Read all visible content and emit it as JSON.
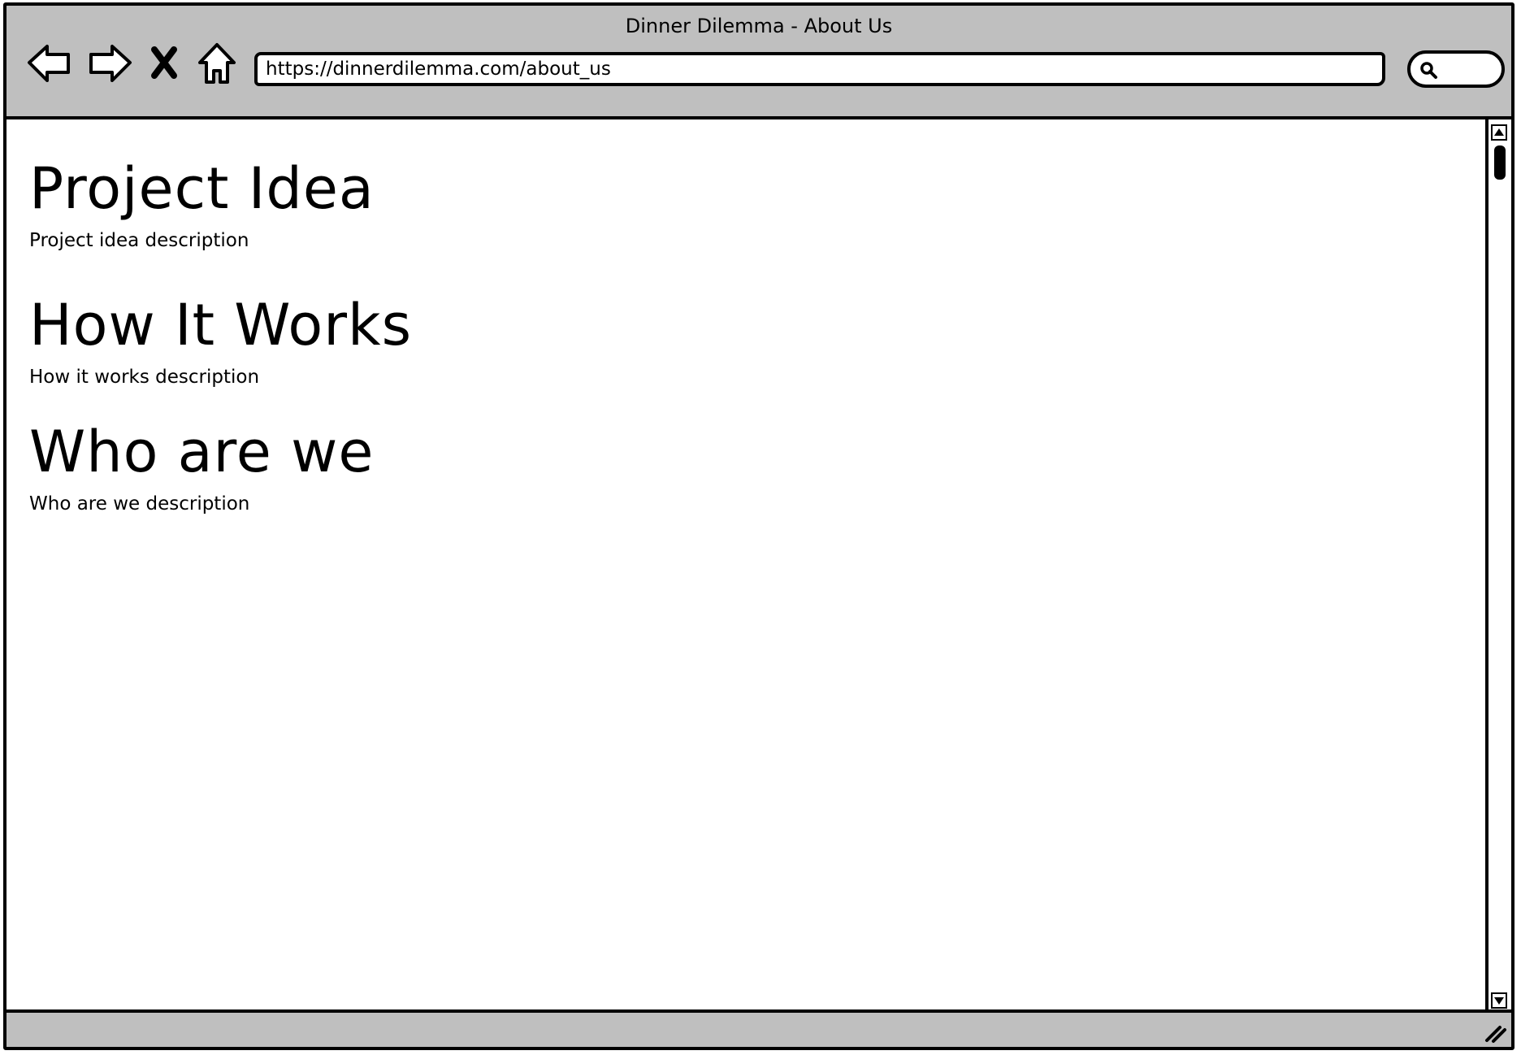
{
  "window": {
    "title": "Dinner Dilemma - About Us"
  },
  "toolbar": {
    "icons": {
      "back": "back-arrow-icon",
      "forward": "forward-arrow-icon",
      "stop": "close-icon",
      "home": "home-icon",
      "search": "search-icon"
    },
    "url": "https://dinnerdilemma.com/about_us",
    "search_value": ""
  },
  "content": {
    "sections": [
      {
        "heading": "Project Idea",
        "description": "Project idea description"
      },
      {
        "heading": "How It Works",
        "description": "How it works description"
      },
      {
        "heading": "Who are we",
        "description": "Who are we description"
      }
    ]
  },
  "colors": {
    "chrome": "#bfbfbf",
    "ink": "#000000",
    "canvas": "#ffffff"
  }
}
